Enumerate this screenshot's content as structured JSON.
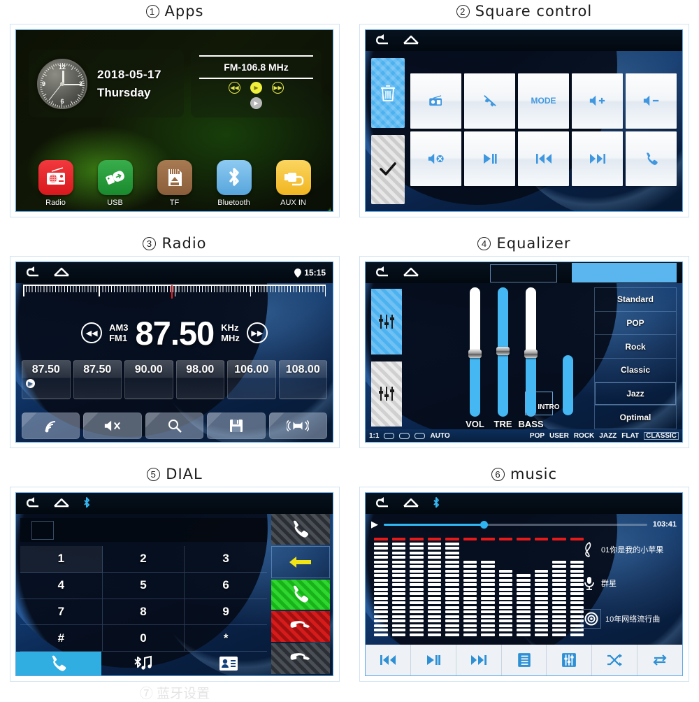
{
  "page": {
    "tail_partial_title": "⑦ 蓝牙设置"
  },
  "panels": [
    {
      "num": "1",
      "title": "Apps",
      "screen": {
        "clock": {
          "digits": [
            "12",
            "3",
            "6",
            "9"
          ]
        },
        "date": "2018-05-17",
        "weekday": "Thursday",
        "fm_label": "FM-106.8  MHz",
        "controls": [
          "prev-track-icon",
          "play-icon",
          "next-track-icon",
          "play-secondary-icon"
        ],
        "apps": [
          {
            "label": "Radio",
            "color": "#e8262a",
            "icon": "radio-icon"
          },
          {
            "label": "USB",
            "color": "#2ba03f",
            "icon": "usb-icon"
          },
          {
            "label": "TF",
            "color": "#9a6a43",
            "icon": "sdcard-icon"
          },
          {
            "label": "Bluetooth",
            "color": "#6fb7e8",
            "icon": "bluetooth-icon"
          },
          {
            "label": "AUX IN",
            "color": "#f5c game",
            "icon": "aux-icon"
          }
        ]
      }
    },
    {
      "num": "2",
      "title": "Square control",
      "screen": {
        "side_tiles": [
          {
            "name": "delete-tile",
            "icon": "trash-icon",
            "style": "blue"
          },
          {
            "name": "confirm-tile",
            "icon": "check-icon",
            "style": "silver"
          }
        ],
        "buttons": [
          {
            "name": "radio-button",
            "icon": "radio-icon",
            "label": ""
          },
          {
            "name": "hangup-button",
            "icon": "phone-hangup-icon",
            "label": ""
          },
          {
            "name": "mode-button",
            "icon": "",
            "label": "MODE"
          },
          {
            "name": "volume-up-button",
            "icon": "volume-plus-icon",
            "label": ""
          },
          {
            "name": "volume-down-button",
            "icon": "volume-minus-icon",
            "label": ""
          },
          {
            "name": "mute-button",
            "icon": "volume-mute-icon",
            "label": ""
          },
          {
            "name": "play-pause-button",
            "icon": "play-pause-icon",
            "label": ""
          },
          {
            "name": "previous-button",
            "icon": "prev-icon",
            "label": ""
          },
          {
            "name": "next-button",
            "icon": "next-icon",
            "label": ""
          },
          {
            "name": "call-button",
            "icon": "phone-icon",
            "label": ""
          }
        ]
      }
    },
    {
      "num": "3",
      "title": "Radio",
      "screen": {
        "status_time": "15:15",
        "band_top": "AM3",
        "band_bottom": "FM1",
        "frequency": "87.50",
        "unit_top": "KHz",
        "unit_bottom": "MHz",
        "presets": [
          "87.50",
          "87.50",
          "90.00",
          "98.00",
          "106.00",
          "108.00"
        ],
        "active_preset_index": 0,
        "bottom_buttons": [
          {
            "name": "band-button",
            "icon": "signal-icon"
          },
          {
            "name": "mute-button",
            "icon": "volume-mute-icon"
          },
          {
            "name": "scan-button",
            "icon": "search-icon"
          },
          {
            "name": "save-button",
            "icon": "save-icon"
          },
          {
            "name": "loudness-button",
            "icon": "loudness-icon"
          }
        ]
      }
    },
    {
      "num": "4",
      "title": "Equalizer",
      "screen": {
        "sliders": [
          {
            "label": "VOL",
            "value": 52
          },
          {
            "label": "TRE",
            "value": 52
          },
          {
            "label": "BASS",
            "value": 52
          }
        ],
        "intro_label": "INTRO",
        "presets": [
          "Standard",
          "POP",
          "Rock",
          "Classic",
          "Jazz",
          "Optimal"
        ],
        "selected_preset": "Jazz",
        "footer": {
          "ratio": "1:1",
          "auto": "AUTO",
          "modes": [
            "POP",
            "USER",
            "ROCK",
            "JAZZ",
            "FLAT",
            "CLASSIC"
          ],
          "selected_mode": "CLASSIC"
        }
      }
    },
    {
      "num": "5",
      "title": "DIAL",
      "screen": {
        "number_value": "",
        "keys": [
          "1",
          "2",
          "3",
          "4",
          "5",
          "6",
          "7",
          "8",
          "9",
          "#",
          "0",
          "*"
        ],
        "side_buttons": [
          {
            "name": "call-log-button",
            "icon": "phone-icon",
            "style": "carbon-dark"
          },
          {
            "name": "backspace-button",
            "icon": "back-arrow-icon",
            "style": "outline"
          },
          {
            "name": "dial-button",
            "icon": "phone-icon",
            "style": "carbon-green"
          },
          {
            "name": "hangup-button",
            "icon": "phone-hangup-icon",
            "style": "carbon-red"
          },
          {
            "name": "end-call-button",
            "icon": "phone-hangup-icon",
            "style": "carbon-dark"
          }
        ],
        "tabs": [
          {
            "name": "tab-dial",
            "icon": "phone-icon",
            "active": true
          },
          {
            "name": "tab-bluetooth-music",
            "icon": "bluetooth-music-icon",
            "active": false
          },
          {
            "name": "tab-contacts",
            "icon": "contacts-icon",
            "active": false
          }
        ]
      }
    },
    {
      "num": "6",
      "title": "music",
      "screen": {
        "elapsed_total": "103:41",
        "progress_percent": 38,
        "track": {
          "title": "01你是我的小苹果",
          "artist": "群星",
          "album": "10年网络流行曲"
        },
        "bottom_buttons": [
          {
            "name": "previous-button",
            "icon": "prev-icon"
          },
          {
            "name": "play-pause-button",
            "icon": "play-pause-icon"
          },
          {
            "name": "next-button",
            "icon": "next-icon"
          },
          {
            "name": "playlist-button",
            "icon": "playlist-icon"
          },
          {
            "name": "equalizer-button",
            "icon": "equalizer-icon"
          },
          {
            "name": "shuffle-button",
            "icon": "shuffle-icon"
          },
          {
            "name": "repeat-button",
            "icon": "repeat-icon"
          }
        ]
      }
    }
  ],
  "colors": {
    "accent_blue": "#3f97e0",
    "panel_blue": "#12417c",
    "highlight": "#5bb6ef",
    "red": "#e81919"
  }
}
